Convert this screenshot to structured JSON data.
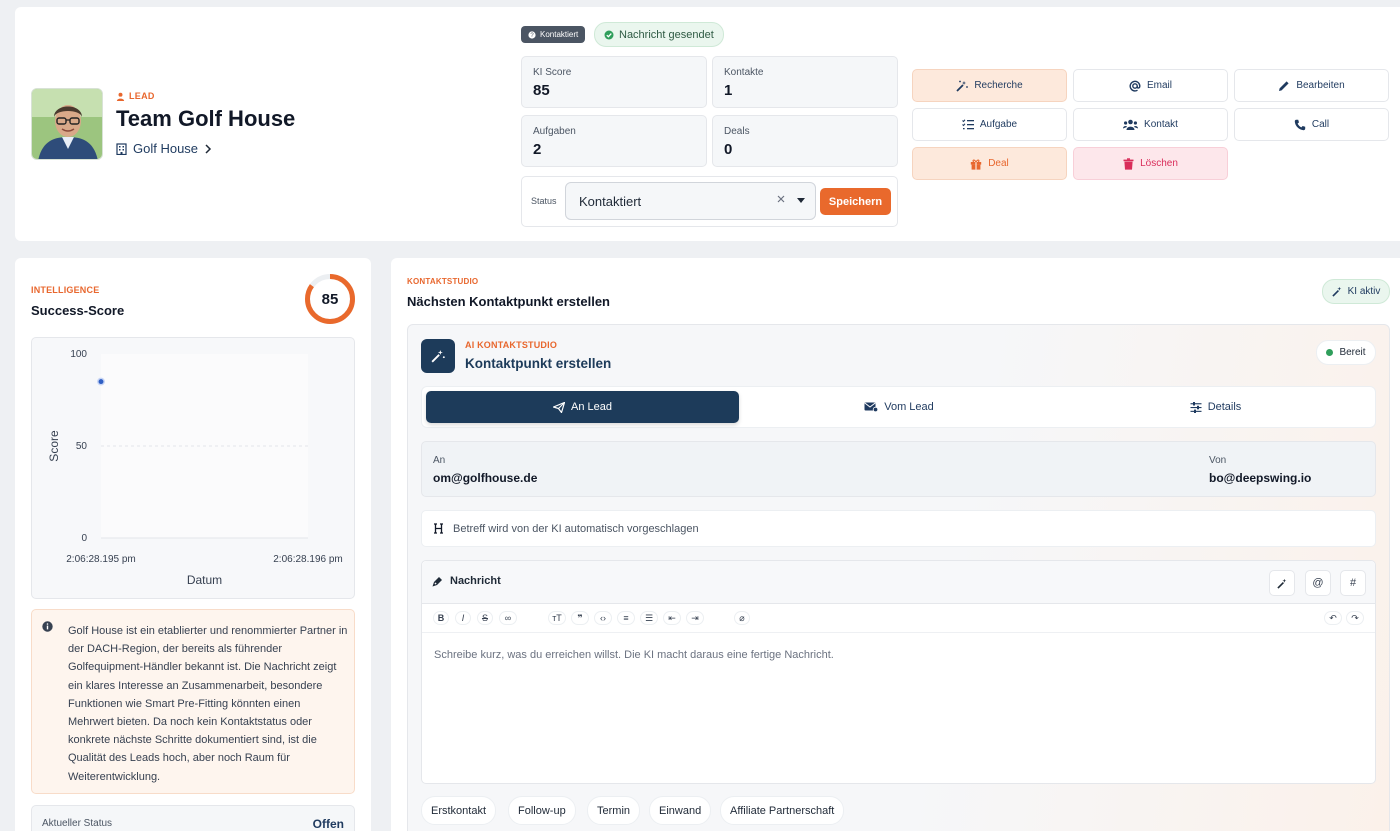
{
  "lead": {
    "tag": "LEAD",
    "name": "Team Golf House",
    "company": "Golf House"
  },
  "badges": {
    "status_pill": "Kontaktiert",
    "sent_pill": "Nachricht gesendet"
  },
  "stats": [
    {
      "label": "KI Score",
      "value": "85"
    },
    {
      "label": "Kontakte",
      "value": "1"
    },
    {
      "label": "Aufgaben",
      "value": "2"
    },
    {
      "label": "Deals",
      "value": "0"
    }
  ],
  "status_form": {
    "label": "Status",
    "selected": "Kontaktiert",
    "save": "Speichern"
  },
  "actions": {
    "recherche": "Recherche",
    "email": "Email",
    "bearbeiten": "Bearbeiten",
    "aufgabe": "Aufgabe",
    "kontakt": "Kontakt",
    "call": "Call",
    "deal": "Deal",
    "loeschen": "Löschen"
  },
  "intelligence": {
    "tag": "INTELLIGENCE",
    "title": "Success-Score",
    "score": 85,
    "score_label": "85",
    "summary": "Golf House ist ein etablierter und renommierter Partner in der DACH-Region, der bereits als führender Golfequipment-Händler bekannt ist. Die Nachricht zeigt ein klares Interesse an Zusammenarbeit, besondere Funktionen wie Smart Pre-Fitting könnten einen Mehrwert bieten. Da noch kein Kontaktstatus oder konkrete nächste Schritte dokumentiert sind, ist die Qualität des Leads hoch, aber noch Raum für Weiterentwicklung.",
    "current_status_label": "Aktueller Status",
    "current_status_value": "Offen"
  },
  "chart_data": {
    "type": "scatter",
    "xlabel": "Datum",
    "ylabel": "Score",
    "ylim": [
      0,
      100
    ],
    "yticks": [
      "100",
      "50",
      "0"
    ],
    "xticks": [
      "2:06:28.195 pm",
      "2:06:28.196 pm"
    ],
    "points": [
      {
        "x": "2:06:28.195 pm",
        "y": 85
      }
    ],
    "grid": true
  },
  "kontaktstudio": {
    "tag": "KONTAKTSTUDIO",
    "title": "Nächsten Kontaktpunkt erstellen",
    "ki_pill": "KI aktiv",
    "inner_tag": "AI KONTAKTSTUDIO",
    "inner_title": "Kontaktpunkt erstellen",
    "ready": "Bereit",
    "tabs": [
      "An Lead",
      "Vom Lead",
      "Details"
    ],
    "to_label": "An",
    "to_value": "om@golfhouse.de",
    "from_label": "Von",
    "from_value": "bo@deepswing.io",
    "subject_placeholder": "Betreff wird von der KI automatisch vorgeschlagen",
    "message_title": "Nachricht",
    "message_placeholder": "Schreibe kurz, was du erreichen willst. Die KI macht daraus eine fertige Nachricht.",
    "chips": [
      "Erstkontakt",
      "Follow-up",
      "Termin",
      "Einwand",
      "Affiliate Partnerschaft"
    ]
  },
  "colors": {
    "accent": "#e9692c",
    "navy": "#1d3b5a",
    "green": "#2f9e5b",
    "danger": "#d92d5a"
  }
}
